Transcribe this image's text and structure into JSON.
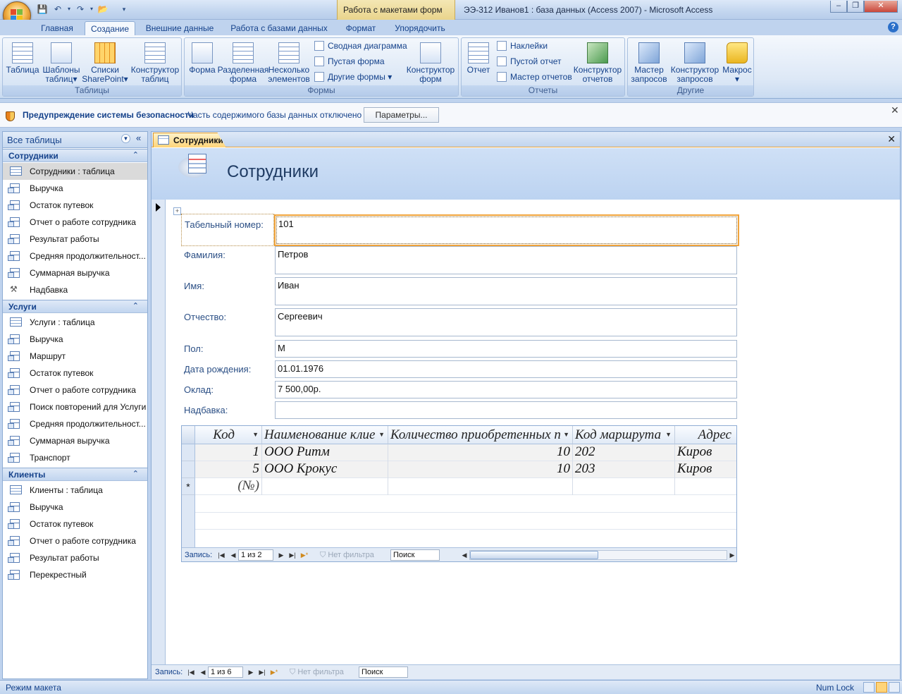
{
  "window": {
    "context_tab": "Работа с макетами форм",
    "title": "ЭЭ-312 Иванов1 : база данных (Access 2007) - Microsoft Access",
    "minimize": "–",
    "maximize": "❐",
    "close": "✕"
  },
  "ribbon_tabs": [
    "Главная",
    "Создание",
    "Внешние данные",
    "Работа с базами данных",
    "Формат",
    "Упорядочить"
  ],
  "ribbon": {
    "tables": {
      "label": "Таблицы",
      "table": "Таблица",
      "templates_1": "Шаблоны",
      "templates_2": "таблиц",
      "sharepoint_1": "Списки",
      "sharepoint_2": "SharePoint",
      "designer_1": "Конструктор",
      "designer_2": "таблиц"
    },
    "forms": {
      "label": "Формы",
      "form": "Форма",
      "split_1": "Разделенная",
      "split_2": "форма",
      "multi_1": "Несколько",
      "multi_2": "элементов",
      "pivot_chart": "Сводная диаграмма",
      "blank_form": "Пустая форма",
      "other_forms": "Другие формы",
      "designer_1": "Конструктор",
      "designer_2": "форм"
    },
    "reports": {
      "label": "Отчеты",
      "report": "Отчет",
      "labels": "Наклейки",
      "blank_report": "Пустой отчет",
      "wizard": "Мастер отчетов",
      "designer_1": "Конструктор",
      "designer_2": "отчетов"
    },
    "other": {
      "label": "Другие",
      "query_wizard_1": "Мастер",
      "query_wizard_2": "запросов",
      "query_designer_1": "Конструктор",
      "query_designer_2": "запросов",
      "macro": "Макрос"
    }
  },
  "security": {
    "title": "Предупреждение системы безопасности",
    "message": "Часть содержимого базы данных отключено",
    "button": "Параметры..."
  },
  "nav": {
    "header": "Все таблицы",
    "groups": [
      {
        "name": "Сотрудники",
        "items": [
          {
            "label": "Сотрудники : таблица",
            "icon": "table-icon"
          },
          {
            "label": "Выручка",
            "icon": "query-icon"
          },
          {
            "label": "Остаток путевок",
            "icon": "query-icon"
          },
          {
            "label": "Отчет о работе сотрудника",
            "icon": "query-icon"
          },
          {
            "label": "Результат работы",
            "icon": "query-icon"
          },
          {
            "label": "Средняя продолжительност...",
            "icon": "query-icon"
          },
          {
            "label": "Суммарная выручка",
            "icon": "query-icon"
          },
          {
            "label": "Надбавка",
            "icon": "macro-icon"
          }
        ]
      },
      {
        "name": "Услуги",
        "items": [
          {
            "label": "Услуги : таблица",
            "icon": "table-icon"
          },
          {
            "label": "Выручка",
            "icon": "query-icon"
          },
          {
            "label": "Маршрут",
            "icon": "query-icon"
          },
          {
            "label": "Остаток путевок",
            "icon": "query-icon"
          },
          {
            "label": "Отчет о работе сотрудника",
            "icon": "query-icon"
          },
          {
            "label": "Поиск повторений для Услуги",
            "icon": "query-icon"
          },
          {
            "label": "Средняя продолжительност...",
            "icon": "query-icon"
          },
          {
            "label": "Суммарная выручка",
            "icon": "query-icon"
          },
          {
            "label": "Транспорт",
            "icon": "query-icon"
          }
        ]
      },
      {
        "name": "Клиенты",
        "items": [
          {
            "label": "Клиенты : таблица",
            "icon": "table-icon"
          },
          {
            "label": "Выручка",
            "icon": "query-icon"
          },
          {
            "label": "Остаток путевок",
            "icon": "query-icon"
          },
          {
            "label": "Отчет о работе сотрудника",
            "icon": "query-icon"
          },
          {
            "label": "Результат работы",
            "icon": "query-icon"
          },
          {
            "label": "Перекрестный",
            "icon": "query-icon"
          }
        ]
      }
    ]
  },
  "document": {
    "tab": "Сотрудники",
    "form_title": "Сотрудники",
    "fields": [
      {
        "label": "Табельный номер:",
        "value": "101"
      },
      {
        "label": "Фамилия:",
        "value": "Петров"
      },
      {
        "label": "Имя:",
        "value": "Иван"
      },
      {
        "label": "Отчество:",
        "value": "Сергеевич"
      },
      {
        "label": "Пол:",
        "value": "М"
      },
      {
        "label": "Дата рождения:",
        "value": "01.01.1976"
      },
      {
        "label": "Оклад:",
        "value": "7 500,00р."
      },
      {
        "label": "Надбавка:",
        "value": ""
      }
    ],
    "subform": {
      "columns": [
        "Код",
        "Наименование клие",
        "Количество приобретенных п",
        "Код маршрута",
        "Адрес"
      ],
      "rows": [
        [
          "1",
          "ООО Ритм",
          "10",
          "202",
          "Киров"
        ],
        [
          "5",
          "ООО Крокус",
          "10",
          "203",
          "Киров"
        ]
      ],
      "new_row_marker": "*",
      "new_row_code": "(№)",
      "nav": {
        "record_label": "Запись:",
        "position": "1 из 2",
        "no_filter": "Нет фильтра",
        "search": "Поиск"
      }
    },
    "form_nav": {
      "record_label": "Запись:",
      "position": "1 из 6",
      "no_filter": "Нет фильтра",
      "search": "Поиск"
    }
  },
  "status": {
    "mode": "Режим макета",
    "numlock": "Num Lock"
  }
}
